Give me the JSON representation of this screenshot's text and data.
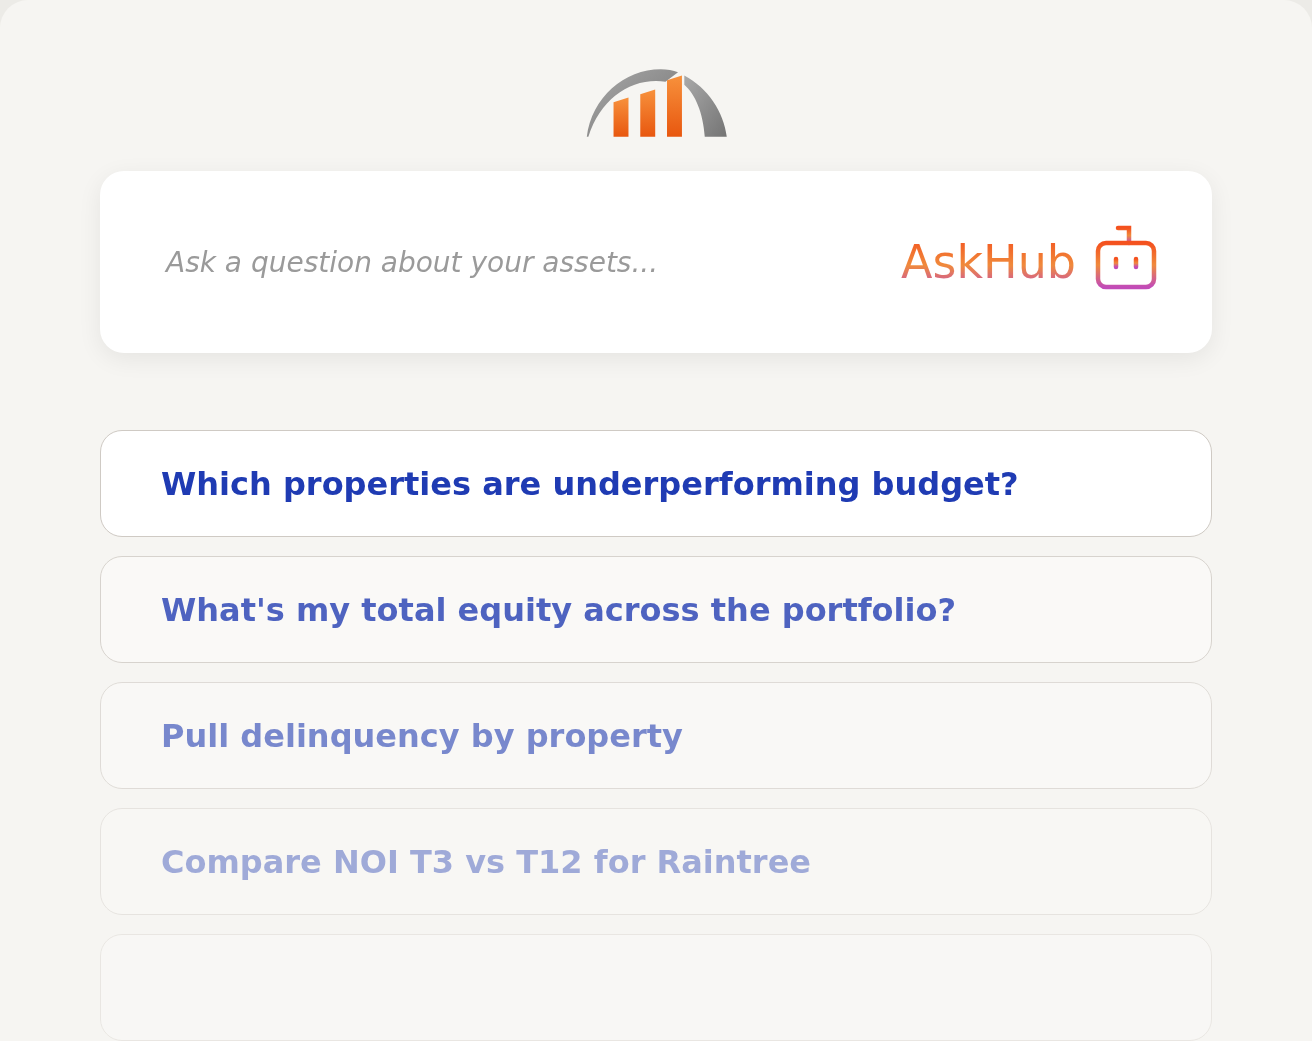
{
  "search": {
    "placeholder": "Ask a question about your assets..."
  },
  "brand": {
    "name": "AskHub"
  },
  "suggestions": [
    {
      "text": "Which properties are underperforming budget?"
    },
    {
      "text": "What's my total equity across the portfolio?"
    },
    {
      "text": "Pull delinquency by property"
    },
    {
      "text": "Compare NOI T3 vs T12 for Raintree"
    }
  ]
}
